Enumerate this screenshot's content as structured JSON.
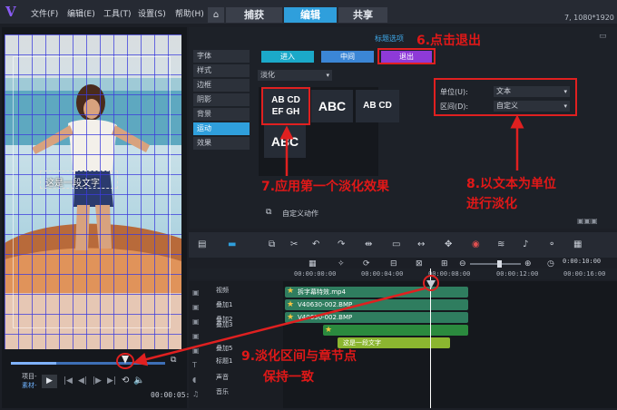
{
  "window": {
    "resolution": "7, 1080*1920",
    "menu": [
      "文件(F)",
      "编辑(E)",
      "工具(T)",
      "设置(S)",
      "帮助(H)"
    ],
    "mode_tabs": [
      "捕获",
      "编辑",
      "共享"
    ],
    "active_mode": "编辑"
  },
  "preview": {
    "caption": "这是一段文字",
    "project_label": "项目-",
    "clip_label": "素材-",
    "timecode": "00:00:05:000",
    "scrub_position": 0.3
  },
  "options": {
    "heading": "标题选项",
    "sidebar": [
      "字体",
      "样式",
      "边框",
      "阴影",
      "背景",
      "运动",
      "效果"
    ],
    "active_sidebar": "运动",
    "anim_tabs": [
      "进入",
      "中间",
      "退出"
    ],
    "active_anim_tab": "退出",
    "effect_type": "淡化",
    "effects": [
      {
        "line1": "AB CD",
        "line2": "EF GH"
      },
      {
        "line1": "ABC",
        "line2": ""
      },
      {
        "line1": "AB CD",
        "line2": ""
      },
      {
        "line1": "ABC",
        "line2": ""
      }
    ],
    "unit_label": "单位(U):",
    "unit_value": "文本",
    "interval_label": "区间(D):",
    "interval_value": "自定义",
    "custom_motion": "自定义动作"
  },
  "timeline": {
    "ruler": [
      "00:00:00:00",
      "00:00:04:00",
      "00:00:08:00",
      "00:00:12:00",
      "00:00:16:00"
    ],
    "right_timecode": "0:00:10:00",
    "tracks": [
      "视频",
      "叠加1",
      "叠加2",
      "叠加3",
      "叠加5",
      "标题1",
      "声音",
      "音乐"
    ],
    "clips": {
      "video": "拆字幕特效.mp4",
      "overlay1": "V40630-002.BMP",
      "overlay2": "V40630-002.BMP",
      "title": "这是一段文字"
    }
  },
  "annotations": {
    "step6": "6.点击退出",
    "step7": "7.应用第一个淡化效果",
    "step8_line1": "8.以文本为单位",
    "step8_line2": "进行淡化",
    "step9_line1": "9.淡化区间与章节点",
    "step9_line2": "保持一致"
  },
  "colors": {
    "accent": "#2f9fdc",
    "anim_enter": "#1ba9c9",
    "anim_middle": "#3b86d6",
    "anim_exit": "#8e3ad8",
    "annotation_red": "#e02020",
    "video_clip": "#2f7d5f",
    "title_clip": "#8bb630"
  }
}
